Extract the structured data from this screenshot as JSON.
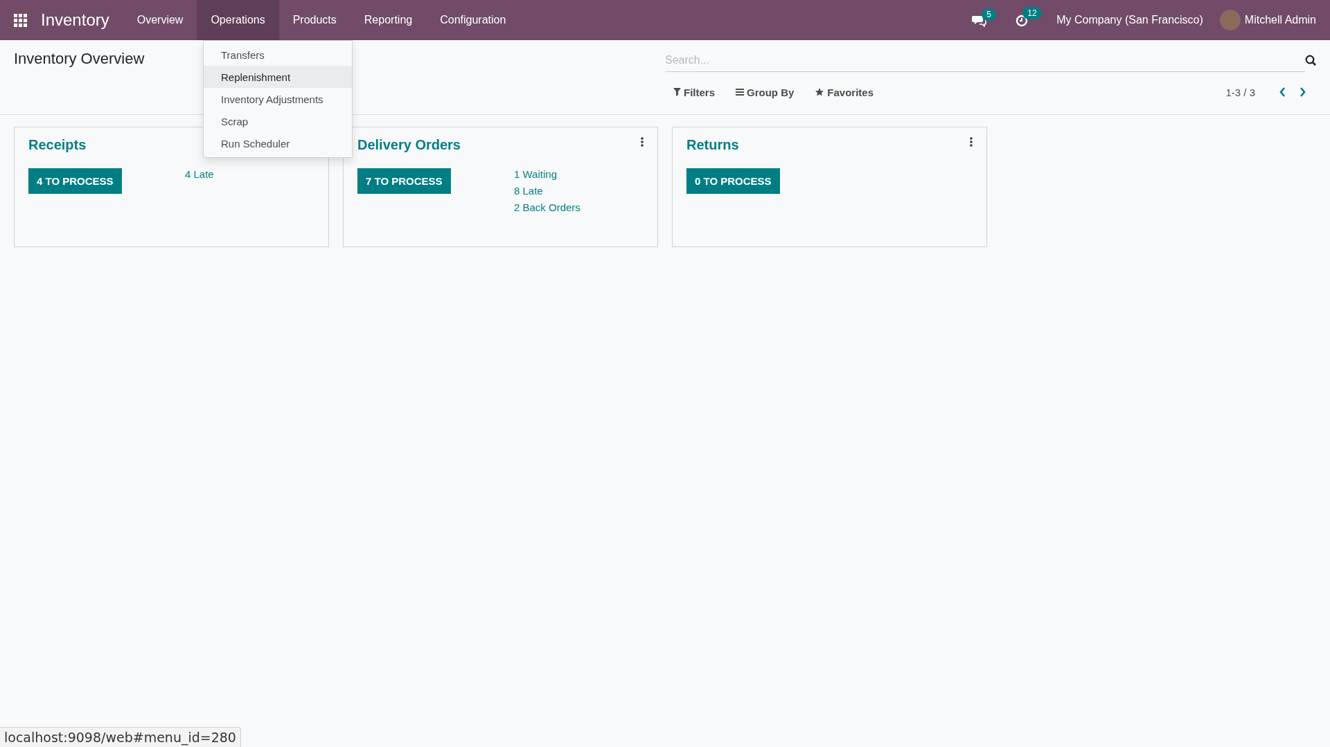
{
  "navbar": {
    "app_name": "Inventory",
    "menu": [
      {
        "label": "Overview",
        "selected": false
      },
      {
        "label": "Operations",
        "selected": true
      },
      {
        "label": "Products",
        "selected": false
      },
      {
        "label": "Reporting",
        "selected": false
      },
      {
        "label": "Configuration",
        "selected": false
      }
    ],
    "messages_count": "5",
    "activities_count": "12",
    "company": "My Company (San Francisco)",
    "user": "Mitchell Admin"
  },
  "dropdown": {
    "items": [
      {
        "label": "Transfers",
        "selected": false
      },
      {
        "label": "Replenishment",
        "selected": true
      },
      {
        "label": "Inventory Adjustments",
        "selected": false
      },
      {
        "label": "Scrap",
        "selected": false
      },
      {
        "label": "Run Scheduler",
        "selected": false
      }
    ]
  },
  "control_panel": {
    "title": "Inventory Overview",
    "search": {
      "placeholder": "Search..."
    },
    "filters": [
      {
        "kind": "filter",
        "label": "Filters"
      },
      {
        "kind": "group",
        "label": "Group By"
      },
      {
        "kind": "favorite",
        "label": "Favorites"
      }
    ],
    "pager": "1-3 / 3"
  },
  "cards": [
    {
      "title": "Receipts",
      "button": "4 TO PROCESS",
      "links": [
        "4 Late"
      ]
    },
    {
      "title": "Delivery Orders",
      "button": "7 TO PROCESS",
      "links": [
        "1 Waiting",
        "8 Late",
        "2 Back Orders"
      ],
      "show_menu": true
    },
    {
      "title": "Returns",
      "button": "0 TO PROCESS",
      "show_menu": true
    }
  ],
  "status_bar": {
    "url": "localhost:9098/web#menu_id=280"
  }
}
